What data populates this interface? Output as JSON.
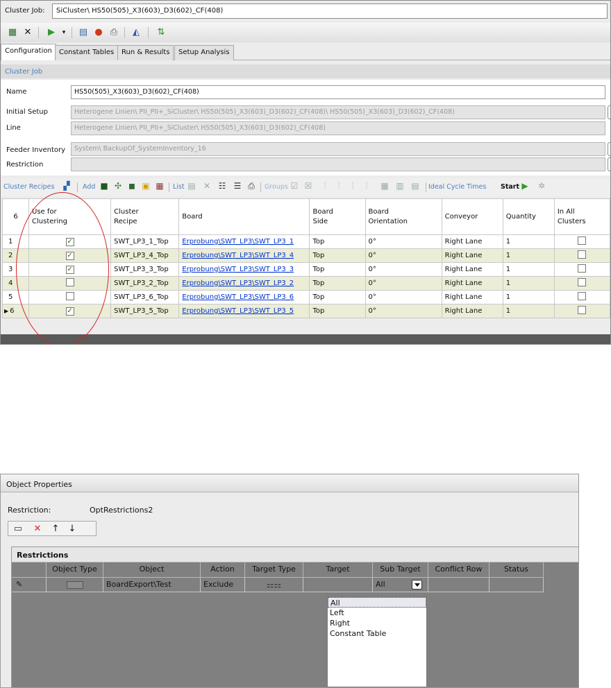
{
  "cluster_job": {
    "label": "Cluster Job:",
    "value": "SiCluster\\ HS50(505)_X3(603)_D3(602)_CF(408)"
  },
  "toolbar": {
    "icons": [
      "cluster-icon",
      "close-icon",
      "run-icon",
      "dropdown-icon",
      "export-icon",
      "help-icon",
      "print-icon",
      "chart-icon",
      "refresh-icon"
    ]
  },
  "tabs": [
    "Configuration",
    "Constant Tables",
    "Run & Results",
    "Setup Analysis"
  ],
  "active_tab": "Configuration",
  "section_title": "Cluster Job",
  "form": {
    "name_label": "Name",
    "name_value": "HS50(505)_X3(603)_D3(602)_CF(408)",
    "initial_setup_label": "Initial Setup",
    "initial_setup_value": "Heterogene Linien\\ PII_PII+_SiCluster\\ HS50(505)_X3(603)_D3(602)_CF(408)\\ HS50(505)_X3(603)_D3(602)_CF(408)",
    "line_label": "Line",
    "line_value": "Heterogene Linien\\ PII_PII+_SiCluster\\ HS50(505)_X3(603)_D3(602)_CF(408)",
    "feeder_label": "Feeder Inventory",
    "feeder_value": "System\\ BackupOf_SystemInventory_16",
    "restriction_label": "Restriction",
    "restriction_value": ""
  },
  "recipes_bar": {
    "cluster_recipes": "Cluster Recipes",
    "add": "Add",
    "list": "List",
    "groups": "Groups",
    "ideal_cycle_times": "Ideal Cycle Times",
    "start": "Start"
  },
  "grid": {
    "row_count_header": "6",
    "headers": [
      "Use for Clustering",
      "Cluster Recipe",
      "Board",
      "Board Side",
      "Board Orientation",
      "Conveyor",
      "Quantity",
      "In All Clusters"
    ],
    "rows": [
      {
        "num": "1",
        "use": true,
        "recipe": "SWT_LP3_1_Top",
        "board": "Erprobung\\SWT_LP3\\SWT_LP3_1",
        "side": "Top",
        "orientation": "0°",
        "conveyor": "Right Lane",
        "quantity": "1",
        "all": false,
        "current": false
      },
      {
        "num": "2",
        "use": true,
        "recipe": "SWT_LP3_4_Top",
        "board": "Erprobung\\SWT_LP3\\SWT_LP3_4",
        "side": "Top",
        "orientation": "0°",
        "conveyor": "Right Lane",
        "quantity": "1",
        "all": false,
        "current": false
      },
      {
        "num": "3",
        "use": true,
        "recipe": "SWT_LP3_3_Top",
        "board": "Erprobung\\SWT_LP3\\SWT_LP3_3",
        "side": "Top",
        "orientation": "0°",
        "conveyor": "Right Lane",
        "quantity": "1",
        "all": false,
        "current": false
      },
      {
        "num": "4",
        "use": false,
        "recipe": "SWT_LP3_2_Top",
        "board": "Erprobung\\SWT_LP3\\SWT_LP3_2",
        "side": "Top",
        "orientation": "0°",
        "conveyor": "Right Lane",
        "quantity": "1",
        "all": false,
        "current": false
      },
      {
        "num": "5",
        "use": false,
        "recipe": "SWT_LP3_6_Top",
        "board": "Erprobung\\SWT_LP3\\SWT_LP3_6",
        "side": "Top",
        "orientation": "0°",
        "conveyor": "Right Lane",
        "quantity": "1",
        "all": false,
        "current": false
      },
      {
        "num": "6",
        "use": true,
        "recipe": "SWT_LP3_5_Top",
        "board": "Erprobung\\SWT_LP3\\SWT_LP3_5",
        "side": "Top",
        "orientation": "0°",
        "conveyor": "Right Lane",
        "quantity": "1",
        "all": false,
        "current": true
      }
    ]
  },
  "object_properties": {
    "title": "Object Properties",
    "restriction_label": "Restriction:",
    "restriction_value": "OptRestrictions2",
    "tools": [
      "new-icon",
      "delete-icon",
      "move-up-icon",
      "move-down-icon"
    ],
    "restrictions_header": "Restrictions",
    "columns": [
      "Object Type",
      "Object",
      "Action",
      "Target Type",
      "Target",
      "Sub Target",
      "Conflict Row",
      "Status"
    ],
    "row": {
      "object": "BoardExport\\Test",
      "action": "Exclude",
      "target": "",
      "sub_target": "All",
      "conflict_row": "",
      "status": ""
    },
    "dropdown_options": [
      "All",
      "Left",
      "Right",
      "Constant Table"
    ],
    "dropdown_selected": "All"
  },
  "colors": {
    "accent": "#4d7dbf",
    "link": "#0033cc",
    "highlight_ring": "#d42020",
    "alt_row": "#ecedd6"
  }
}
